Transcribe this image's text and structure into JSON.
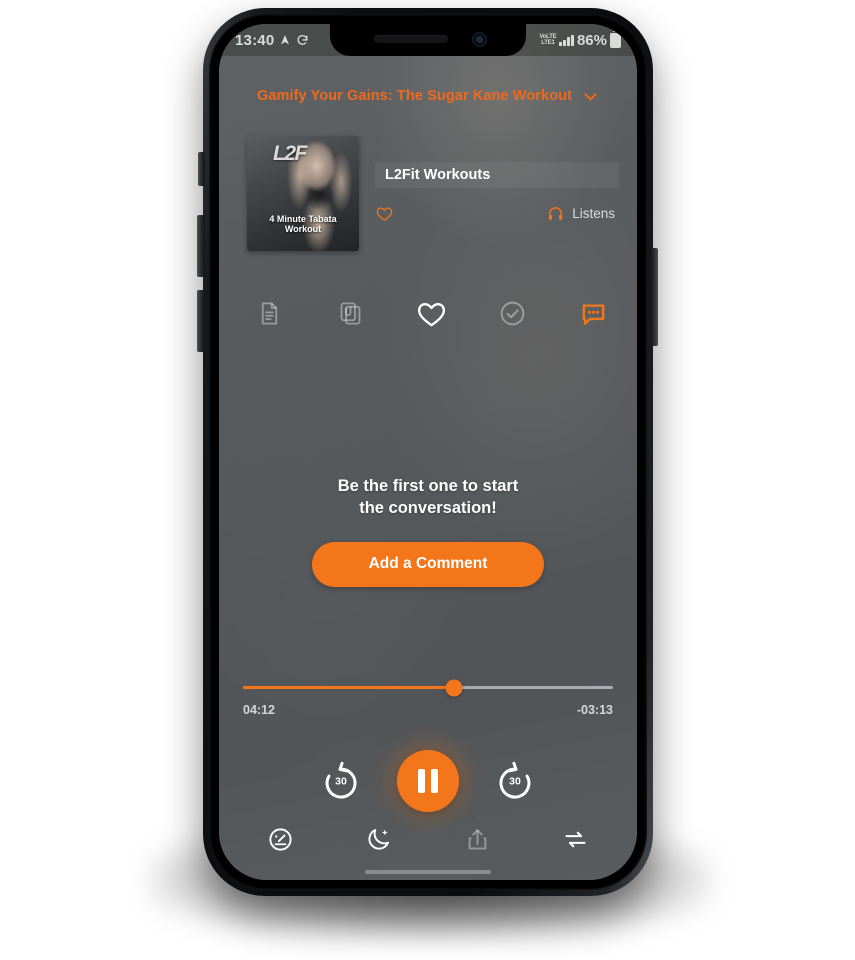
{
  "status_bar": {
    "time": "13:40",
    "location_icon": "location-arrow-icon",
    "rotation_icon": "auto-rotate-icon",
    "network_label_top": "VoLTE",
    "network_label_bottom": "LTE1",
    "signal_icon": "signal-bars-icon",
    "battery_percent": "86%",
    "battery_icon": "battery-full-icon"
  },
  "header": {
    "episode_title": "Gamify Your Gains: The Sugar Kane Workout",
    "collapse_icon": "chevron-down-icon"
  },
  "now_playing": {
    "artwork_logo": "L2F",
    "artwork_caption": "4 Minute Tabata Workout",
    "artwork_alt": "podcast-artwork",
    "show_title": "L2Fit Workouts",
    "favorite_icon": "heart-outline-icon",
    "listens_icon": "headphones-icon",
    "listens_label": "Listens"
  },
  "action_icons": [
    {
      "name": "notes-icon",
      "label": "Notes",
      "state": "dim"
    },
    {
      "name": "clip-icon",
      "label": "Clips",
      "state": "dim"
    },
    {
      "name": "heart-icon",
      "label": "Like",
      "state": "bright"
    },
    {
      "name": "check-circle-icon",
      "label": "Mark as played",
      "state": "dim"
    },
    {
      "name": "comment-icon",
      "label": "Comments",
      "state": "active"
    }
  ],
  "empty_state": {
    "line1": "Be the first one to start",
    "line2": "the conversation!",
    "cta_label": "Add a Comment"
  },
  "player": {
    "elapsed": "04:12",
    "remaining": "-03:13",
    "progress_percent": 57,
    "rewind_seconds": "30",
    "forward_seconds": "30",
    "rewind_icon": "rewind-30-icon",
    "forward_icon": "forward-30-icon",
    "play_state_icon": "pause-icon"
  },
  "toolbar": [
    {
      "name": "playback-speed-icon",
      "label": "Speed",
      "state": "bright"
    },
    {
      "name": "sleep-timer-icon",
      "label": "Sleep timer",
      "state": "bright"
    },
    {
      "name": "share-icon",
      "label": "Share",
      "state": "dim"
    },
    {
      "name": "repeat-icon",
      "label": "Repeat",
      "state": "bright"
    }
  ],
  "colors": {
    "accent": "#f4761b",
    "screen_bg": "#5d6164",
    "text_primary": "#ffffff",
    "text_muted": "#d4d7d8"
  }
}
